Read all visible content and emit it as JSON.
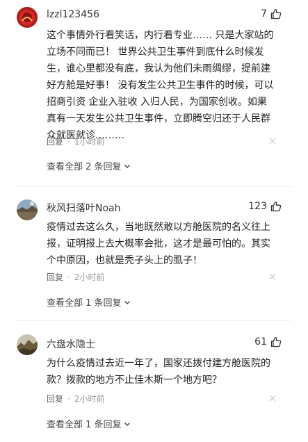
{
  "comments": [
    {
      "username": "lzzl123456",
      "likes": "7",
      "text": "这个事情外行看笑话，内行看专业…… 只是大家站的立场不同而已！ 世界公共卫生事件到底什么时候发生，谁心里都没有底，我认为他们未雨绸缪，提前建好方舱是好事！ 没有发生公共卫生事件的时候，可以招商引资 企业入驻收 入归人民，为国家创收。如果真有一天发生公共卫生事件，立即腾空归还于人民群众就医就诊………",
      "reply_label": "回复",
      "separator": "·",
      "time": "1小时前",
      "view_all": "查看全部 2 条回复"
    },
    {
      "username": "秋风扫落叶Noah",
      "likes": "123",
      "text": "疫情过去这么久，当地既然敢以方舱医院的名义往上报，证明报上去大概率会批，这才是最可怕的。其实个中原因，也就是秃子头上的虱子！",
      "reply_label": "回复",
      "separator": "·",
      "time": "2小时前",
      "view_all": "查看全部 1 条回复"
    },
    {
      "username": "六盘水隐士",
      "likes": "61",
      "text": "为什么疫情过去近一年了，国家还拨付建方舱医院的款？拨款的地方不止佳木斯一个地方吧？",
      "reply_label": "回复",
      "separator": "·",
      "time": "2小时前",
      "view_all": "查看全部 1 条回复"
    }
  ],
  "icons": {
    "like": "thumbs-up-icon",
    "dismiss": "close-icon",
    "expand": "chevron-down-icon"
  },
  "colors": {
    "text_primary": "#222222",
    "text_secondary": "#888888",
    "icon": "#333333"
  }
}
